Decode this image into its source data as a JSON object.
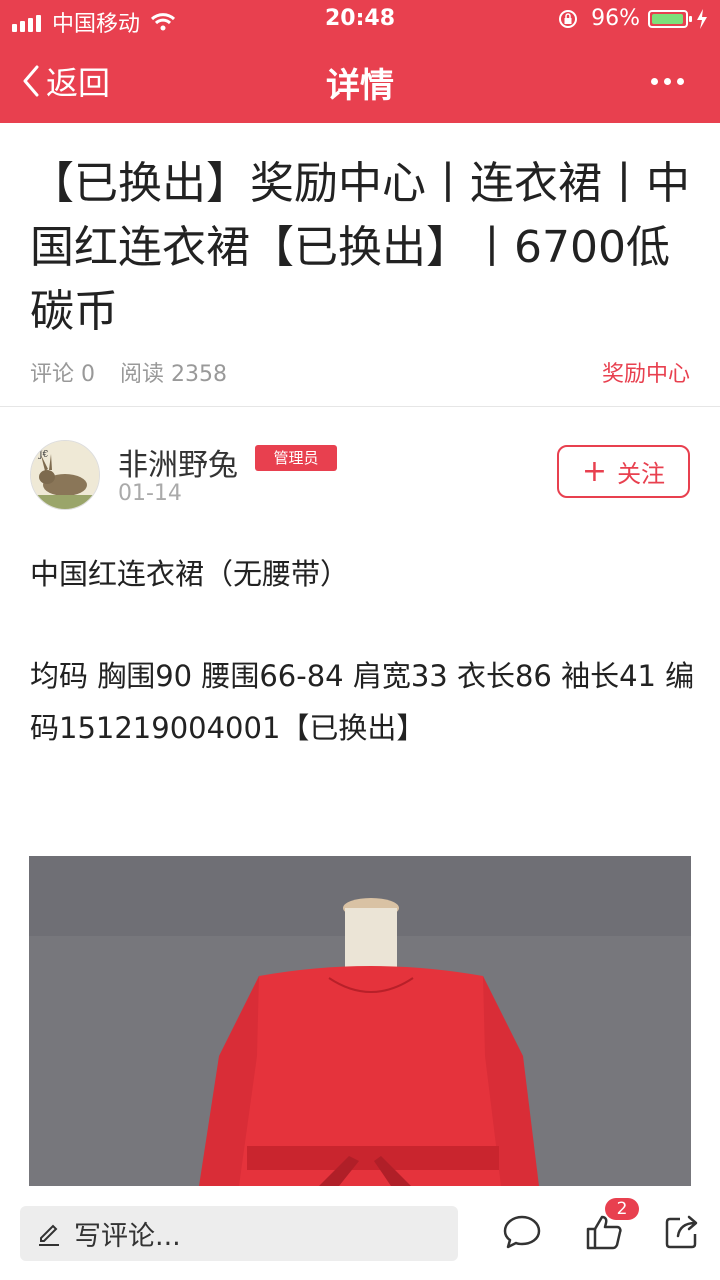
{
  "status_bar": {
    "carrier": "中国移动",
    "time": "20:48",
    "battery": "96%"
  },
  "nav": {
    "back_label": "返回",
    "title": "详情"
  },
  "article": {
    "title": "【已换出】奖励中心丨连衣裙丨中国红连衣裙【已换出】丨6700低碳币",
    "comments_label": "评论 0",
    "reads_label": "阅读 2358",
    "category": "奖励中心"
  },
  "author": {
    "name": "非洲野兔",
    "role_badge": "管理员",
    "date": "01-14",
    "follow_label": "关注"
  },
  "content": {
    "line1": "中国红连衣裙（无腰带）",
    "line2": "均码  胸围90  腰围66-84  肩宽33  衣长86  袖长41  编码151219004001【已换出】"
  },
  "bottom_bar": {
    "comment_placeholder": "写评论...",
    "like_count": "2"
  },
  "icons": {
    "back": "chevron-left-icon",
    "more": "more-dots-icon",
    "follow": "plus-icon",
    "write": "pencil-icon",
    "comment": "speech-bubble-icon",
    "like": "thumbs-up-icon",
    "share": "share-icon"
  },
  "colors": {
    "brand": "#e8404f",
    "muted_text": "#999999"
  }
}
